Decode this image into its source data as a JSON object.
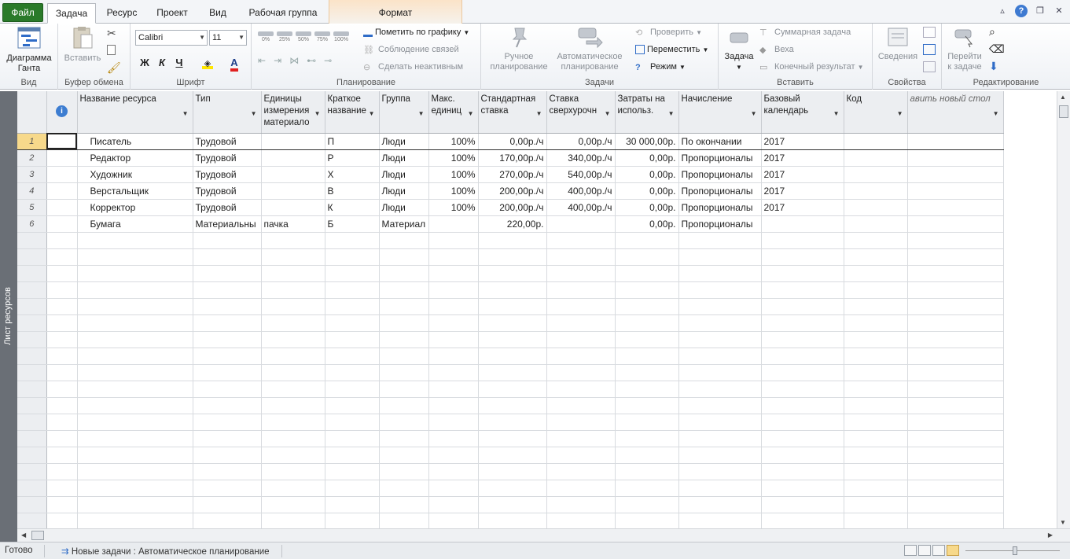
{
  "tabs": {
    "file": "Файл",
    "items": [
      "Задача",
      "Ресурс",
      "Проект",
      "Вид",
      "Рабочая группа"
    ],
    "context": "Формат"
  },
  "ribbon": {
    "view_group": {
      "gantt_line1": "Диаграмма",
      "gantt_line2": "Ганта",
      "label": "Вид"
    },
    "clipboard_group": {
      "paste": "Вставить",
      "label": "Буфер обмена"
    },
    "font_group": {
      "font_name": "Calibri",
      "font_size": "11",
      "bold": "Ж",
      "italic": "К",
      "underline": "Ч",
      "label": "Шрифт"
    },
    "schedule_group": {
      "percents": [
        "0%",
        "25%",
        "50%",
        "75%",
        "100%"
      ],
      "mark_on_track": "Пометить по графику",
      "respect_links": "Соблюдение связей",
      "inactivate": "Сделать неактивным",
      "label": "Планирование"
    },
    "tasks_group": {
      "manual_line1": "Ручное",
      "manual_line2": "планирование",
      "auto_line1": "Автоматическое",
      "auto_line2": "планирование",
      "inspect": "Проверить",
      "move": "Переместить",
      "mode": "Режим",
      "label": "Задачи"
    },
    "insert_group": {
      "task": "Задача",
      "summary": "Суммарная задача",
      "milestone": "Веха",
      "deliverable": "Конечный результат",
      "label": "Вставить"
    },
    "properties_group": {
      "info": "Сведения",
      "label": "Свойства"
    },
    "editing_group": {
      "goto_line1": "Перейти",
      "goto_line2": "к задаче",
      "label": "Редактирование"
    }
  },
  "side_label": "Лист ресурсов",
  "grid": {
    "columns": [
      "Название ресурса",
      "Тип",
      "Единицы измерения материало",
      "Краткое название",
      "Группа",
      "Макс. единиц",
      "Стандартная ставка",
      "Ставка сверхурочн",
      "Затраты на использ.",
      "Начисление",
      "Базовый календарь",
      "Код",
      "авить новый стол"
    ],
    "rows": [
      {
        "n": "1",
        "name": "Писатель",
        "type": "Трудовой",
        "mat": "",
        "short": "П",
        "group": "Люди",
        "max": "100%",
        "std": "0,00р./ч",
        "ovt": "0,00р./ч",
        "cost": "30 000,00р.",
        "accrue": "По окончании",
        "cal": "2017",
        "code": ""
      },
      {
        "n": "2",
        "name": "Редактор",
        "type": "Трудовой",
        "mat": "",
        "short": "Р",
        "group": "Люди",
        "max": "100%",
        "std": "170,00р./ч",
        "ovt": "340,00р./ч",
        "cost": "0,00р.",
        "accrue": "Пропорционалы",
        "cal": "2017",
        "code": ""
      },
      {
        "n": "3",
        "name": "Художник",
        "type": "Трудовой",
        "mat": "",
        "short": "Х",
        "group": "Люди",
        "max": "100%",
        "std": "270,00р./ч",
        "ovt": "540,00р./ч",
        "cost": "0,00р.",
        "accrue": "Пропорционалы",
        "cal": "2017",
        "code": ""
      },
      {
        "n": "4",
        "name": "Верстальщик",
        "type": "Трудовой",
        "mat": "",
        "short": "В",
        "group": "Люди",
        "max": "100%",
        "std": "200,00р./ч",
        "ovt": "400,00р./ч",
        "cost": "0,00р.",
        "accrue": "Пропорционалы",
        "cal": "2017",
        "code": ""
      },
      {
        "n": "5",
        "name": "Корректор",
        "type": "Трудовой",
        "mat": "",
        "short": "К",
        "group": "Люди",
        "max": "100%",
        "std": "200,00р./ч",
        "ovt": "400,00р./ч",
        "cost": "0,00р.",
        "accrue": "Пропорционалы",
        "cal": "2017",
        "code": ""
      },
      {
        "n": "6",
        "name": "Бумага",
        "type": "Материальны",
        "mat": "пачка",
        "short": "Б",
        "group": "Материал",
        "max": "",
        "std": "220,00р.",
        "ovt": "",
        "cost": "0,00р.",
        "accrue": "Пропорционалы",
        "cal": "",
        "code": ""
      }
    ]
  },
  "status": {
    "ready": "Готово",
    "new_tasks": "Новые задачи : Автоматическое планирование"
  },
  "colors": {
    "file_tab": "#2a7a2a",
    "selected_row": "#f7d98b",
    "info": "#3d7dd1"
  }
}
